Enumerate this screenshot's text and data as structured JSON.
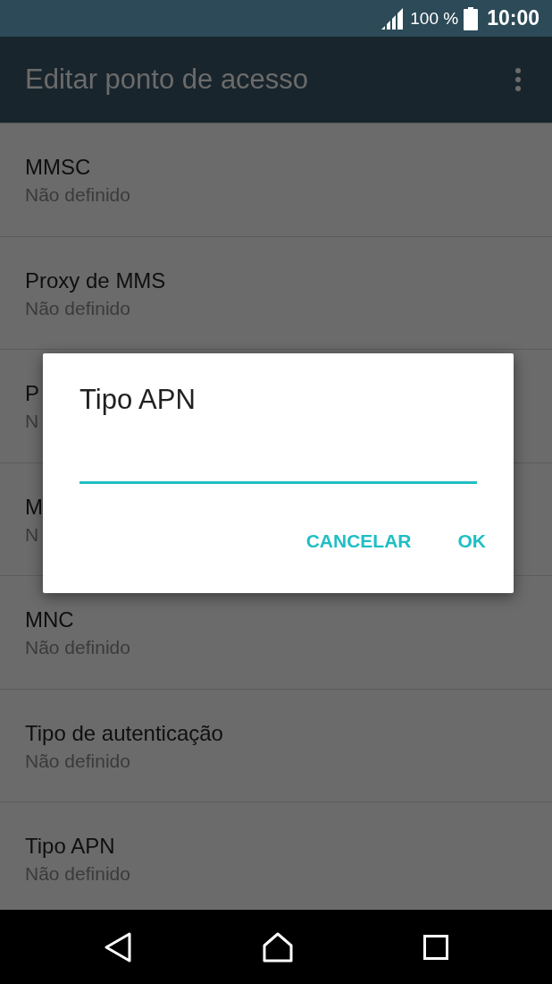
{
  "status_bar": {
    "battery": "100 %",
    "time": "10:00"
  },
  "app_bar": {
    "title": "Editar ponto de acesso"
  },
  "settings": [
    {
      "label": "MMSC",
      "value": "Não definido"
    },
    {
      "label": "Proxy de MMS",
      "value": "Não definido"
    },
    {
      "label": "P",
      "value": "N"
    },
    {
      "label": "M",
      "value": "N"
    },
    {
      "label": "MNC",
      "value": "Não definido"
    },
    {
      "label": "Tipo de autenticação",
      "value": "Não definido"
    },
    {
      "label": "Tipo APN",
      "value": "Não definido"
    }
  ],
  "dialog": {
    "title": "Tipo APN",
    "buttons": [
      "CANCELAR",
      "OK"
    ]
  }
}
